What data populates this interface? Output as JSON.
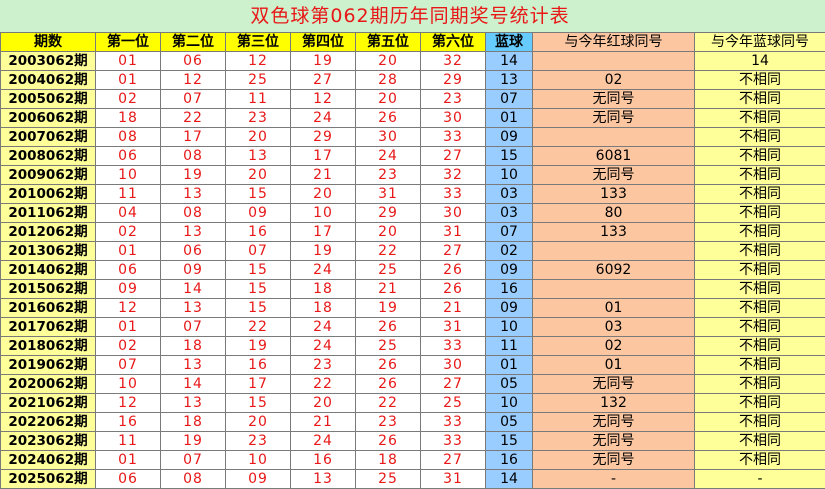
{
  "title": "双色球第062期历年同期奖号统计表",
  "headers": [
    "期数",
    "第一位",
    "第二位",
    "第三位",
    "第四位",
    "第五位",
    "第六位",
    "蓝球",
    "与今年红球同号",
    "与今年蓝球同号"
  ],
  "rows": [
    {
      "period": "2003062期",
      "reds": [
        "01",
        "06",
        "12",
        "19",
        "20",
        "32"
      ],
      "blue": "14",
      "red_same": "",
      "blue_same": "14"
    },
    {
      "period": "2004062期",
      "reds": [
        "01",
        "12",
        "25",
        "27",
        "28",
        "29"
      ],
      "blue": "13",
      "red_same": "02",
      "blue_same": "不相同"
    },
    {
      "period": "2005062期",
      "reds": [
        "02",
        "07",
        "11",
        "12",
        "20",
        "23"
      ],
      "blue": "07",
      "red_same": "无同号",
      "blue_same": "不相同"
    },
    {
      "period": "2006062期",
      "reds": [
        "18",
        "22",
        "23",
        "24",
        "26",
        "30"
      ],
      "blue": "01",
      "red_same": "无同号",
      "blue_same": "不相同"
    },
    {
      "period": "2007062期",
      "reds": [
        "08",
        "17",
        "20",
        "29",
        "30",
        "33"
      ],
      "blue": "09",
      "red_same": "",
      "blue_same": "不相同"
    },
    {
      "period": "2008062期",
      "reds": [
        "06",
        "08",
        "13",
        "17",
        "24",
        "27"
      ],
      "blue": "15",
      "red_same": "6081",
      "blue_same": "不相同"
    },
    {
      "period": "2009062期",
      "reds": [
        "10",
        "19",
        "20",
        "21",
        "23",
        "32"
      ],
      "blue": "10",
      "red_same": "无同号",
      "blue_same": "不相同"
    },
    {
      "period": "2010062期",
      "reds": [
        "11",
        "13",
        "15",
        "20",
        "31",
        "33"
      ],
      "blue": "03",
      "red_same": "133",
      "blue_same": "不相同"
    },
    {
      "period": "2011062期",
      "reds": [
        "04",
        "08",
        "09",
        "10",
        "29",
        "30"
      ],
      "blue": "03",
      "red_same": "80",
      "blue_same": "不相同"
    },
    {
      "period": "2012062期",
      "reds": [
        "02",
        "13",
        "16",
        "17",
        "20",
        "31"
      ],
      "blue": "07",
      "red_same": "133",
      "blue_same": "不相同"
    },
    {
      "period": "2013062期",
      "reds": [
        "01",
        "06",
        "07",
        "19",
        "22",
        "27"
      ],
      "blue": "02",
      "red_same": "",
      "blue_same": "不相同"
    },
    {
      "period": "2014062期",
      "reds": [
        "06",
        "09",
        "15",
        "24",
        "25",
        "26"
      ],
      "blue": "09",
      "red_same": "6092",
      "blue_same": "不相同"
    },
    {
      "period": "2015062期",
      "reds": [
        "09",
        "14",
        "15",
        "18",
        "21",
        "26"
      ],
      "blue": "16",
      "red_same": "",
      "blue_same": "不相同"
    },
    {
      "period": "2016062期",
      "reds": [
        "12",
        "13",
        "15",
        "18",
        "19",
        "21"
      ],
      "blue": "09",
      "red_same": "01",
      "blue_same": "不相同"
    },
    {
      "period": "2017062期",
      "reds": [
        "01",
        "07",
        "22",
        "24",
        "26",
        "31"
      ],
      "blue": "10",
      "red_same": "03",
      "blue_same": "不相同"
    },
    {
      "period": "2018062期",
      "reds": [
        "02",
        "18",
        "19",
        "24",
        "25",
        "33"
      ],
      "blue": "11",
      "red_same": "02",
      "blue_same": "不相同"
    },
    {
      "period": "2019062期",
      "reds": [
        "07",
        "13",
        "16",
        "23",
        "26",
        "30"
      ],
      "blue": "01",
      "red_same": "01",
      "blue_same": "不相同"
    },
    {
      "period": "2020062期",
      "reds": [
        "10",
        "14",
        "17",
        "22",
        "26",
        "27"
      ],
      "blue": "05",
      "red_same": "无同号",
      "blue_same": "不相同"
    },
    {
      "period": "2021062期",
      "reds": [
        "12",
        "13",
        "15",
        "20",
        "22",
        "25"
      ],
      "blue": "10",
      "red_same": "132",
      "blue_same": "不相同"
    },
    {
      "period": "2022062期",
      "reds": [
        "16",
        "18",
        "20",
        "21",
        "23",
        "33"
      ],
      "blue": "05",
      "red_same": "无同号",
      "blue_same": "不相同"
    },
    {
      "period": "2023062期",
      "reds": [
        "11",
        "19",
        "23",
        "24",
        "26",
        "33"
      ],
      "blue": "15",
      "red_same": "无同号",
      "blue_same": "不相同"
    },
    {
      "period": "2024062期",
      "reds": [
        "01",
        "07",
        "10",
        "16",
        "18",
        "27"
      ],
      "blue": "16",
      "red_same": "无同号",
      "blue_same": "不相同"
    },
    {
      "period": "2025062期",
      "reds": [
        "06",
        "08",
        "09",
        "13",
        "25",
        "31"
      ],
      "blue": "14",
      "red_same": "-",
      "blue_same": "-"
    }
  ],
  "colors": {
    "title_bg": "#cdf0cd",
    "title_text": "#e81818",
    "header_bg": "#ffff00",
    "period_bg": "#ffff99",
    "red_number": "#e81818",
    "blue_col_bg": "#99ccff",
    "blue_header_bg": "#66ccff",
    "red_same_bg": "#fcc6a0",
    "blue_same_bg": "#ffff99"
  }
}
